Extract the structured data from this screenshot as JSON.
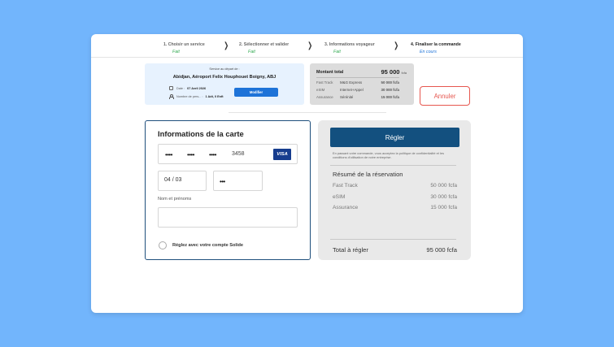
{
  "stepper": {
    "steps": [
      {
        "label": "1. Choisir un service",
        "status": "Fait"
      },
      {
        "label": "2. Sélectionner et valider",
        "status": "Fait"
      },
      {
        "label": "3. Informations voyageur",
        "status": "Fait"
      },
      {
        "label": "4. Finaliser la commande",
        "status": "En cours"
      }
    ]
  },
  "service": {
    "label": "Service au départ de :",
    "airport": "Abidjan, Aéroport Felix Houphouet Boigny, ABJ",
    "date_label": "Date :",
    "date_value": "07 Avril 2026",
    "persons_label": "Nombre de pers... :",
    "persons_value": "1 Adt, 0 Enft",
    "modify_label": "Modifier"
  },
  "total": {
    "label": "Montant total",
    "amount": "95 000",
    "currency": "fcfa",
    "items": [
      {
        "name": "Fast Track",
        "desc": "M&G Express",
        "price": "50 000 fcfa"
      },
      {
        "name": "eSIM",
        "desc": "Internet+Appel",
        "price": "30 000 fcfa"
      },
      {
        "name": "Assurance",
        "desc": "Sérénité",
        "price": "15 000 fcfa"
      }
    ]
  },
  "cancel_label": "Annuler",
  "card": {
    "title": "Informations de la carte",
    "masked_group": "••••",
    "last4": "3458",
    "brand": "VISA",
    "expiry": "04 / 03",
    "cvv_mask": "•••",
    "name_label": "Nom et prénoms",
    "name_value": "",
    "solde_label": "Réglez avec votre compte Solide"
  },
  "payment": {
    "button_label": "Régler",
    "legal": "En passant votre commande, vous acceptez la politique de confidentialité et les conditions d'utilisation de notre entreprise.",
    "summary_title": "Résumé de la réservation",
    "items": [
      {
        "name": "Fast Track",
        "price": "50 000 fcfa"
      },
      {
        "name": "eSIM",
        "price": "30 000 fcfa"
      },
      {
        "name": "Assurance",
        "price": "15 000 fcfa"
      }
    ],
    "total_label": "Total à régler",
    "total_value": "95 000 fcfa"
  },
  "colors": {
    "background": "#72b5fc",
    "primary": "#1e73d8",
    "dark_blue": "#13507f",
    "danger": "#e6574f",
    "success": "#2fa84f"
  }
}
